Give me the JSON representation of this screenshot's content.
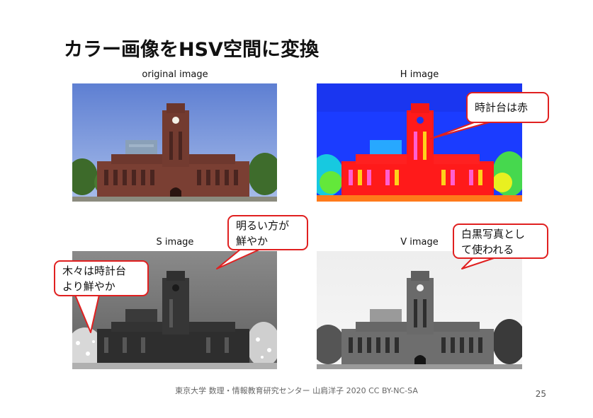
{
  "slide": {
    "title": "カラー画像をHSV空間に変換",
    "footer": "東京大学 数理・情報教育研究センター 山肩洋子 2020 CC BY-NC-SA",
    "page_number": "25"
  },
  "panels": [
    {
      "caption": "original image"
    },
    {
      "caption": "H image"
    },
    {
      "caption": "S image"
    },
    {
      "caption": "V image"
    }
  ],
  "callouts": {
    "h_clock_red": "時計台は赤",
    "s_bright_vivid": [
      "明るい方が",
      "鮮やか"
    ],
    "s_trees_vivid": [
      "木々は時計台",
      "より鮮やか"
    ],
    "v_grayscale": [
      "白黒写真とし",
      "て使われる"
    ]
  },
  "colors": {
    "accent": "#e02020",
    "original_sky": "#6f8fd8",
    "h_sky": "#1b3cff",
    "h_building": "#ff1a1a",
    "s_sky": "#7a7a7a",
    "v_sky": "#f2f2f2"
  }
}
